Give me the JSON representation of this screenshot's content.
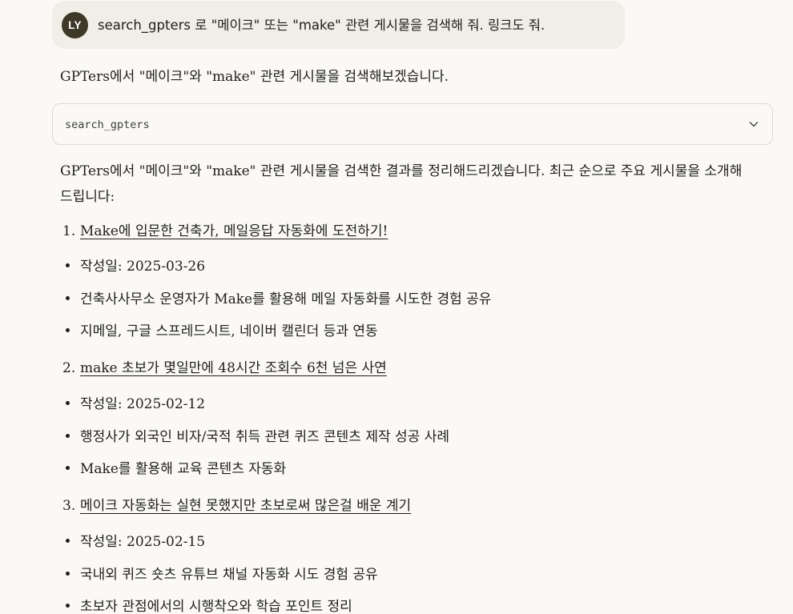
{
  "user_message": {
    "avatar_initials": "LY",
    "text": "search_gpters 로 \"메이크\" 또는 \"make\" 관련 게시물을 검색해 줘. 링크도 줘."
  },
  "assistant": {
    "intro": "GPTers에서 \"메이크\"와 \"make\" 관련 게시물을 검색해보겠습니다.",
    "tool_call": {
      "name": "search_gpters",
      "icon": "chevron-down-icon"
    },
    "summary": "GPTers에서 \"메이크\"와 \"make\" 관련 게시물을 검색한 결과를 정리해드리겠습니다. 최근 순으로 주요 게시물을 소개해드립니다:",
    "results": [
      {
        "number": "1.",
        "title": "Make에 입문한 건축가, 메일응답 자동화에 도전하기!",
        "bullets": [
          "작성일: 2025-03-26",
          "건축사사무소 운영자가 Make를 활용해 메일 자동화를 시도한 경험 공유",
          "지메일, 구글 스프레드시트, 네이버 캘린더 등과 연동"
        ]
      },
      {
        "number": "2.",
        "title": "make 초보가 몇일만에 48시간 조회수 6천 넘은 사연",
        "bullets": [
          "작성일: 2025-02-12",
          "행정사가 외국인 비자/국적 취득 관련 퀴즈 콘텐츠 제작 성공 사례",
          "Make를 활용해 교육 콘텐츠 자동화"
        ]
      },
      {
        "number": "3.",
        "title": "메이크 자동화는 실현 못했지만 초보로써 많은걸 배운 계기",
        "bullets": [
          "작성일: 2025-02-15",
          "국내외 퀴즈 숏츠 유튜브 채널 자동화 시도 경험 공유",
          "초보자 관점에서의 시행착오와 학습 포인트 정리"
        ]
      }
    ]
  }
}
